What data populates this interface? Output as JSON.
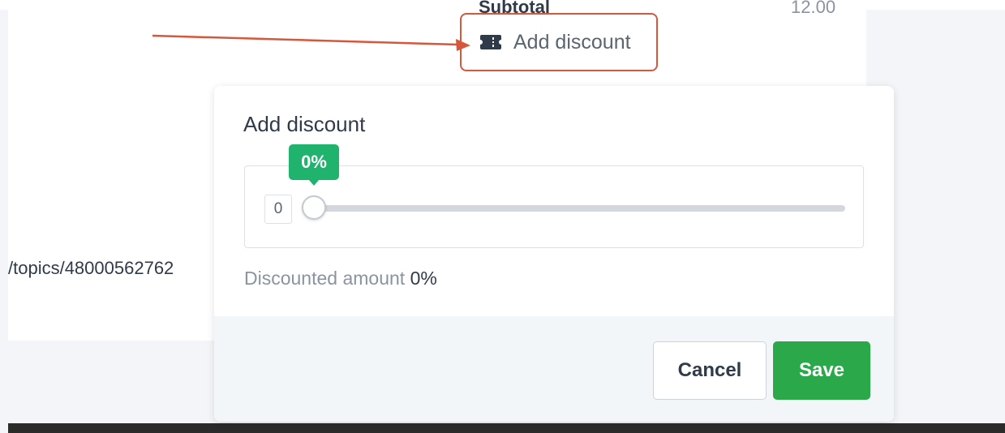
{
  "background": {
    "subtotal_label": "Subtotal",
    "subtotal_value": "12.00",
    "add_discount_link": "Add discount",
    "topics_url": "/topics/48000562762"
  },
  "modal": {
    "title": "Add discount",
    "slider": {
      "input_value": "0",
      "tooltip": "0%",
      "value_percent": 0
    },
    "discounted_label": "Discounted amount",
    "discounted_value": "0%",
    "cancel_label": "Cancel",
    "save_label": "Save"
  },
  "colors": {
    "accent_green": "#2aa84a",
    "tooltip_green": "#1fb36d",
    "annotation_red": "#d6583c"
  },
  "icons": {
    "discount": "ticket-icon"
  }
}
